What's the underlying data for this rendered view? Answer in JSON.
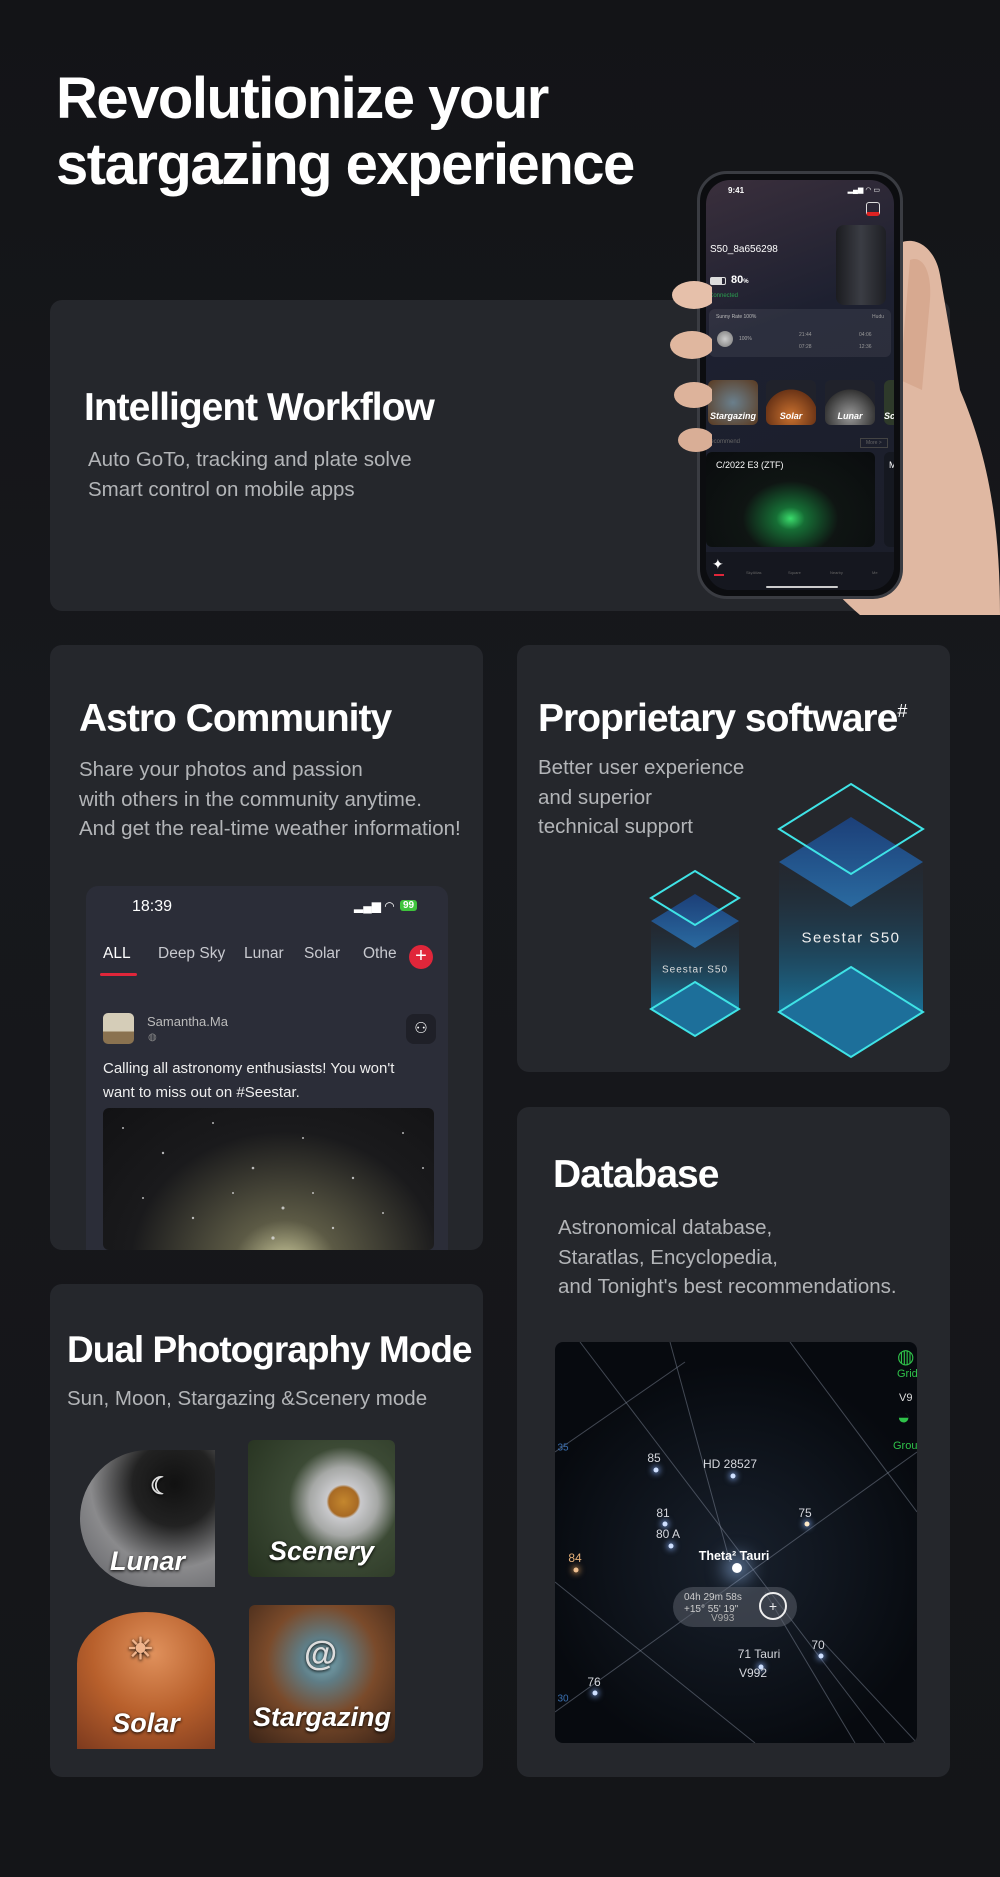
{
  "headline": {
    "line1": "Revolutionize your",
    "line2": "stargazing experience"
  },
  "workflow": {
    "title": "Intelligent Workflow",
    "lines": [
      "Auto GoTo, tracking and plate solve",
      "Smart control on mobile apps"
    ],
    "phone": {
      "time": "9:41",
      "device": "S50_8a656298",
      "battery": "80",
      "battery_unit": "%",
      "status": "Connected",
      "weather_title": "Sunny Rate 100%",
      "location": "Hudu",
      "moon_pct": "100%",
      "moonrise": "21:44",
      "moonset": "07:28",
      "sunrise": "04:06",
      "sunset": "12:36",
      "tiles": [
        "Stargazing",
        "Solar",
        "Lunar",
        "Sc"
      ],
      "recommend": "Recommend",
      "more": "More >",
      "featured": "C/2022 E3 (ZTF)",
      "featured_next": "M",
      "nav": [
        "Home",
        "SkyAtlas",
        "Square",
        "Nearby",
        "Me"
      ],
      "accent": "#e0263a"
    }
  },
  "community": {
    "title": "Astro Community",
    "lines": [
      "Share your photos and passion",
      "with others in the community anytime.",
      "And get the real-time weather information!"
    ],
    "app": {
      "time": "18:39",
      "battery": "99",
      "tabs": [
        "ALL",
        "Deep Sky",
        "Lunar",
        "Solar",
        "Othe"
      ],
      "active_tab": "ALL",
      "user": "Samantha.Ma",
      "post_line1": "Calling all astronomy enthusiasts! You won't",
      "post_line2": "want to miss out on #Seestar."
    }
  },
  "software": {
    "title": "Proprietary software",
    "mark": "#",
    "lines": [
      "Better user experience",
      "and superior",
      "technical  support"
    ],
    "small_label": "Seestar S50",
    "big_label": "Seestar S50",
    "accent": "#3fe3e6"
  },
  "database": {
    "title": "Database",
    "lines": [
      "Astronomical database,",
      "Staratlas, Encyclopedia,",
      "and Tonight's best recommendations."
    ],
    "map": {
      "labels": [
        "85",
        "HD 28527",
        "81",
        "80 A",
        "84",
        "75",
        "70",
        "71 Tauri",
        "V992",
        "76"
      ],
      "target": "Theta² Tauri",
      "ra": "04h 29m 58s",
      "dec": "+15° 55' 19\"",
      "under": "V993",
      "grid": "Grid",
      "ground": "Ground",
      "side_label": "V9",
      "grid_numbers": [
        "35",
        "30"
      ],
      "accent": "#2fc24a"
    }
  },
  "dual": {
    "title": "Dual Photography Mode",
    "subtitle": "Sun, Moon, Stargazing &Scenery mode",
    "modes": [
      "Lunar",
      "Scenery",
      "Solar",
      "Stargazing"
    ]
  }
}
